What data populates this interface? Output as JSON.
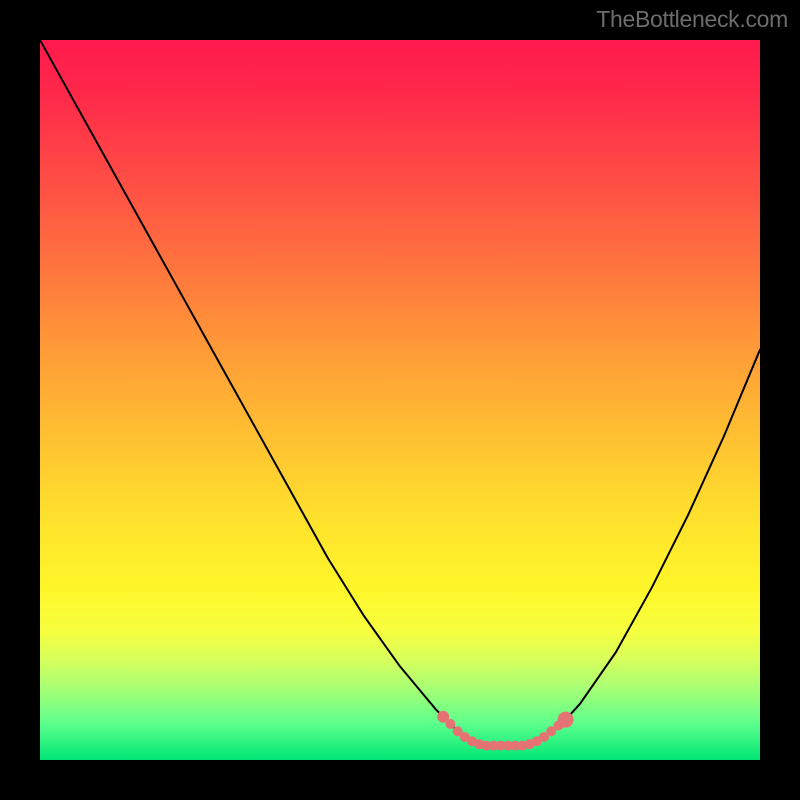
{
  "watermark": {
    "text": "TheBottleneck.com"
  },
  "chart_data": {
    "type": "line",
    "title": "",
    "xlabel": "",
    "ylabel": "",
    "xlim": [
      0,
      100
    ],
    "ylim": [
      0,
      100
    ],
    "grid": false,
    "series": [
      {
        "name": "curve",
        "x": [
          0,
          5,
          10,
          15,
          20,
          25,
          30,
          35,
          40,
          45,
          50,
          55,
          56,
          57,
          58,
          59,
          60,
          61,
          62,
          63,
          64,
          65,
          66,
          67,
          68,
          69,
          70,
          71,
          72,
          73,
          75,
          80,
          85,
          90,
          95,
          100
        ],
        "values": [
          100,
          91,
          82,
          73,
          64,
          55,
          46,
          37,
          28,
          20,
          13,
          7,
          6,
          5,
          4,
          3.2,
          2.6,
          2.2,
          2,
          2,
          2,
          2,
          2,
          2,
          2.2,
          2.6,
          3.2,
          4,
          4.8,
          5.6,
          7.8,
          15,
          24,
          34,
          45,
          57
        ]
      }
    ],
    "markers": {
      "name": "highlight-dots",
      "color": "#e57373",
      "x": [
        56,
        57,
        58,
        59,
        60,
        61,
        62,
        63,
        64,
        65,
        66,
        67,
        68,
        69,
        70,
        71,
        72,
        73
      ],
      "values": [
        6,
        5,
        4,
        3.2,
        2.6,
        2.2,
        2,
        2,
        2,
        2,
        2,
        2,
        2.2,
        2.6,
        3.2,
        4,
        4.8,
        5.6
      ],
      "radius": [
        6,
        5,
        5,
        5,
        5,
        5,
        5,
        5,
        5,
        5,
        5,
        5,
        5,
        5,
        5,
        5,
        5,
        8
      ]
    },
    "gradient_stops": [
      {
        "pos": 0,
        "color": "#ff1a4d"
      },
      {
        "pos": 8,
        "color": "#ff2a4a"
      },
      {
        "pos": 22,
        "color": "#ff5544"
      },
      {
        "pos": 38,
        "color": "#ff8a3a"
      },
      {
        "pos": 52,
        "color": "#ffb733"
      },
      {
        "pos": 66,
        "color": "#ffe02d"
      },
      {
        "pos": 76,
        "color": "#fff62a"
      },
      {
        "pos": 82,
        "color": "#f7ff3e"
      },
      {
        "pos": 86,
        "color": "#d8ff5c"
      },
      {
        "pos": 90,
        "color": "#a8ff74"
      },
      {
        "pos": 95,
        "color": "#5cff8c"
      },
      {
        "pos": 100,
        "color": "#00e676"
      }
    ]
  }
}
